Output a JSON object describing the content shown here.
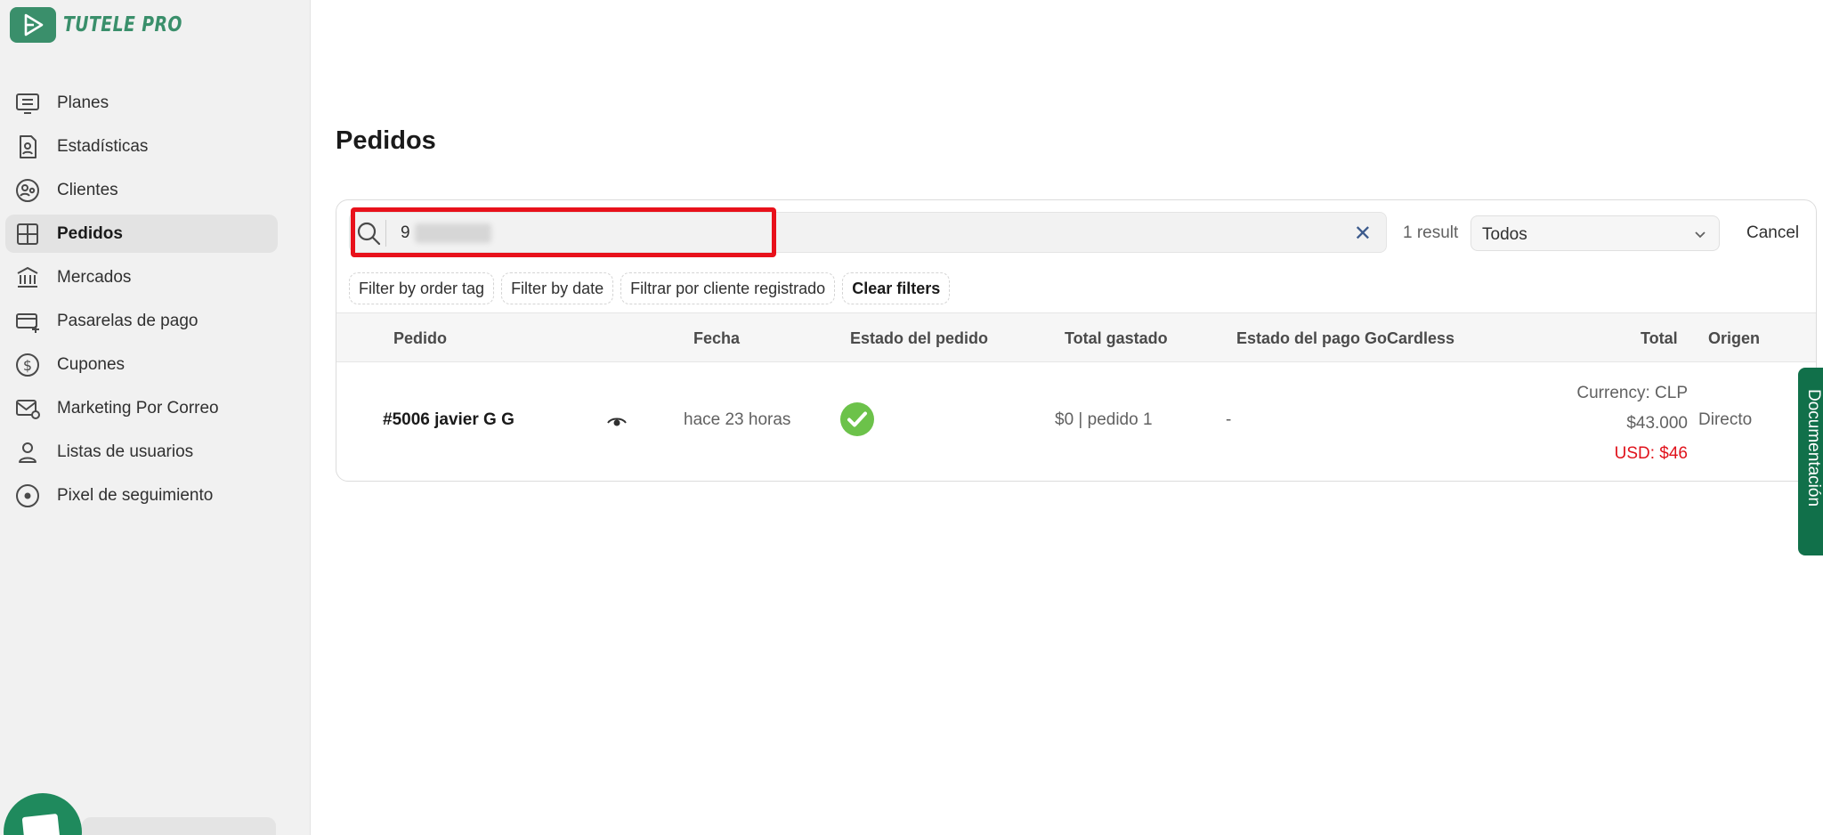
{
  "app": {
    "brand": "TUTELE PRO",
    "logo_icon": "play-logo-icon",
    "accent_color": "#3a8f6b"
  },
  "sidebar": {
    "items": [
      {
        "label": "Planes",
        "icon": "plans-icon"
      },
      {
        "label": "Estadísticas",
        "icon": "stats-icon"
      },
      {
        "label": "Clientes",
        "icon": "customers-icon"
      },
      {
        "label": "Pedidos",
        "icon": "orders-icon",
        "active": true
      },
      {
        "label": "Mercados",
        "icon": "markets-icon"
      },
      {
        "label": "Pasarelas de pago",
        "icon": "payment-gateway-icon"
      },
      {
        "label": "Cupones",
        "icon": "coupon-icon"
      },
      {
        "label": "Marketing Por Correo",
        "icon": "email-marketing-icon"
      },
      {
        "label": "Listas de usuarios",
        "icon": "user-lists-icon"
      },
      {
        "label": "Pixel de seguimiento",
        "icon": "tracking-pixel-icon"
      }
    ]
  },
  "page": {
    "title": "Pedidos"
  },
  "search": {
    "value": "9",
    "result_count": "1 result",
    "status_select": "Todos",
    "cancel_label": "Cancel"
  },
  "filters": {
    "order_tag": "Filter by order tag",
    "date": "Filter by date",
    "registered_customer": "Filtrar por cliente registrado",
    "clear": "Clear filters"
  },
  "table": {
    "headers": {
      "pedido": "Pedido",
      "fecha": "Fecha",
      "estado": "Estado del pedido",
      "total_gastado": "Total gastado",
      "gocardless": "Estado del pago GoCardless",
      "total": "Total",
      "origen": "Origen"
    },
    "rows": [
      {
        "order": "#5006 javier G G",
        "date": "hace 23 horas",
        "status_icon": "check-circle-icon",
        "spent": "$0 | pedido 1",
        "gocardless": "-",
        "currency": "Currency: CLP",
        "amount": "$43.000",
        "usd": "USD: $46",
        "origin": "Directo"
      }
    ]
  },
  "documentation_tab": "Documentación",
  "colors": {
    "highlight": "#e8111b",
    "success": "#6cc24a",
    "usd": "#e0121b",
    "doc_tab": "#11704a"
  }
}
